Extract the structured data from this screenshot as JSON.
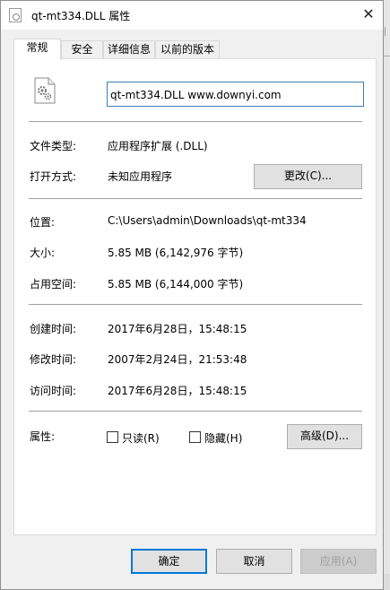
{
  "window": {
    "title": "qt-mt334.DLL 属性",
    "close_glyph": "✕"
  },
  "tabs": [
    {
      "label": "常规",
      "active": true
    },
    {
      "label": "安全",
      "active": false
    },
    {
      "label": "详细信息",
      "active": false
    },
    {
      "label": "以前的版本",
      "active": false
    }
  ],
  "general": {
    "file_name_value": "qt-mt334.DLL www.downyi.com",
    "file_type": {
      "label": "文件类型:",
      "value": "应用程序扩展 (.DLL)"
    },
    "opens_with": {
      "label": "打开方式:",
      "value": "未知应用程序",
      "change_button": "更改(C)..."
    },
    "location": {
      "label": "位置:",
      "value": "C:\\Users\\admin\\Downloads\\qt-mt334"
    },
    "size": {
      "label": "大小:",
      "value": "5.85 MB (6,142,976 字节)"
    },
    "size_on_disk": {
      "label": "占用空间:",
      "value": "5.85 MB (6,144,000 字节)"
    },
    "created": {
      "label": "创建时间:",
      "value": "2017年6月28日，15:48:15"
    },
    "modified": {
      "label": "修改时间:",
      "value": "2007年2月24日，21:53:48"
    },
    "accessed": {
      "label": "访问时间:",
      "value": "2017年6月28日，15:48:15"
    },
    "attributes": {
      "label": "属性:",
      "readonly_label": "只读(R)",
      "readonly_checked": false,
      "hidden_label": "隐藏(H)",
      "hidden_checked": false,
      "advanced_button": "高级(D)..."
    }
  },
  "footer": {
    "ok": "确定",
    "cancel": "取消",
    "apply": "应用(A)"
  },
  "icons": {
    "title_icon": "dll-file-icon",
    "file_icon": "dll-gear-file-icon"
  },
  "colors": {
    "input_border": "#3c7fb1",
    "primary_border": "#0078d7",
    "disabled_text": "#a0a0a0"
  }
}
